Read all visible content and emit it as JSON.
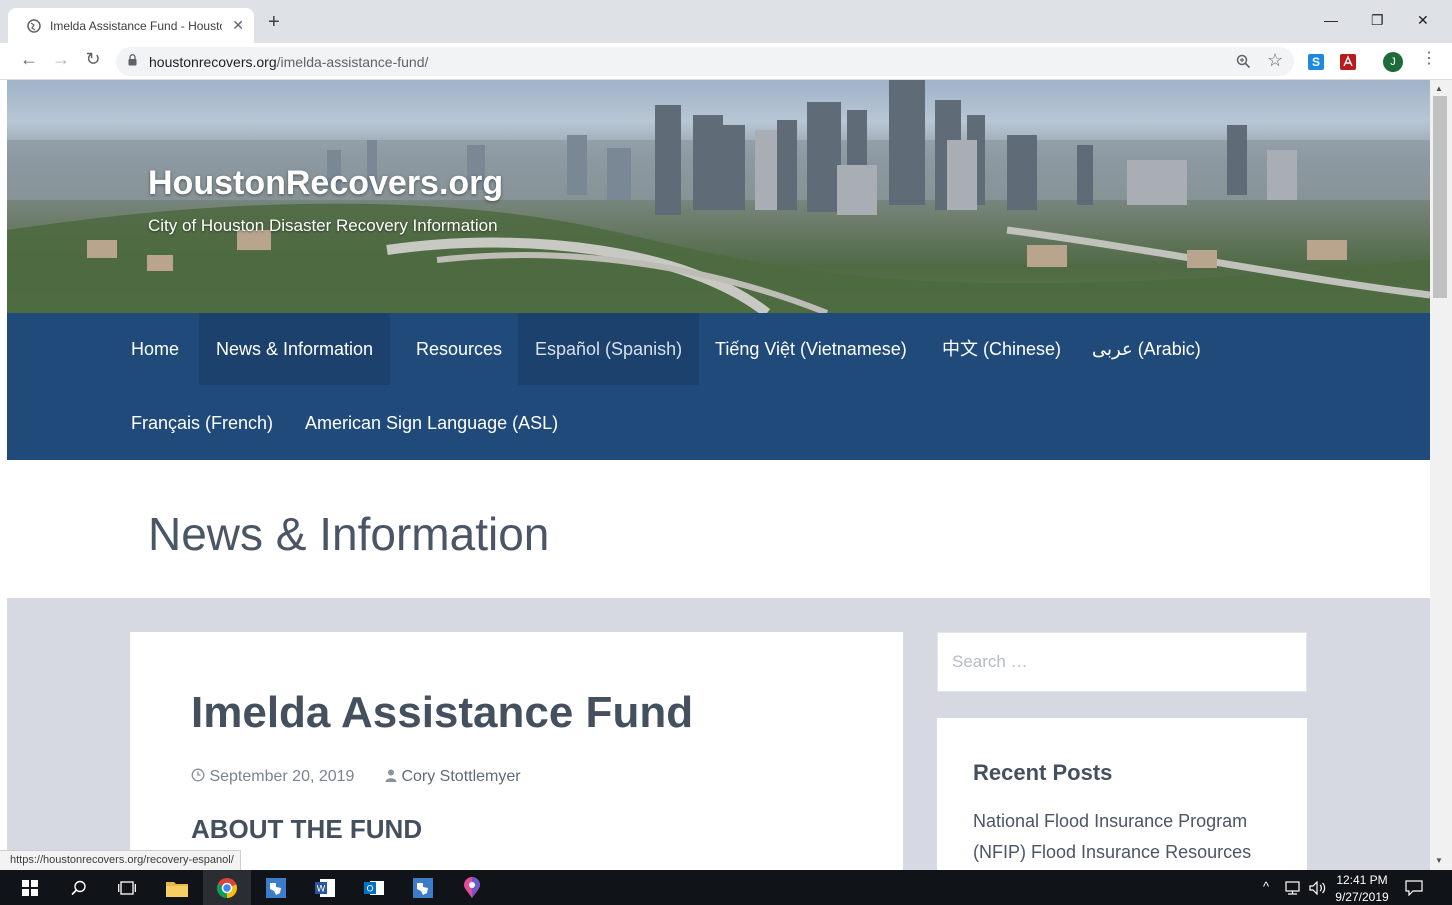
{
  "browser": {
    "tab_title": "Imelda Assistance Fund - Housto",
    "url_host": "houstonrecovers.org",
    "url_path": "/imelda-assistance-fund/",
    "status_url": "https://houstonrecovers.org/recovery-espanol/",
    "profile_initial": "J"
  },
  "site": {
    "title": "HoustonRecovers.org",
    "tagline": "City of Houston Disaster Recovery Information"
  },
  "nav": {
    "items": [
      {
        "label": "Home"
      },
      {
        "label": "News & Information"
      },
      {
        "label": "Resources"
      },
      {
        "label": "Español (Spanish)"
      },
      {
        "label": "Tiếng Việt (Vietnamese)"
      },
      {
        "label": "中文 (Chinese)"
      },
      {
        "label": "عربى (Arabic)"
      },
      {
        "label": "Français (French)"
      },
      {
        "label": "American Sign Language (ASL)"
      }
    ]
  },
  "page": {
    "heading": "News & Information"
  },
  "article": {
    "title": "Imelda Assistance Fund",
    "date": "September 20, 2019",
    "author": "Cory Stottlemyer",
    "section_heading": "ABOUT THE FUND"
  },
  "sidebar": {
    "search_placeholder": "Search …",
    "recent_posts_title": "Recent Posts",
    "recent_post_line1": "National Flood Insurance Program",
    "recent_post_line2": "(NFIP) Flood Insurance Resources"
  },
  "taskbar": {
    "time": "12:41 PM",
    "date": "9/27/2019"
  },
  "colors": {
    "nav_bg": "#1f4a7a",
    "content_bg": "#d7d9e2",
    "heading_text": "#45505f"
  }
}
